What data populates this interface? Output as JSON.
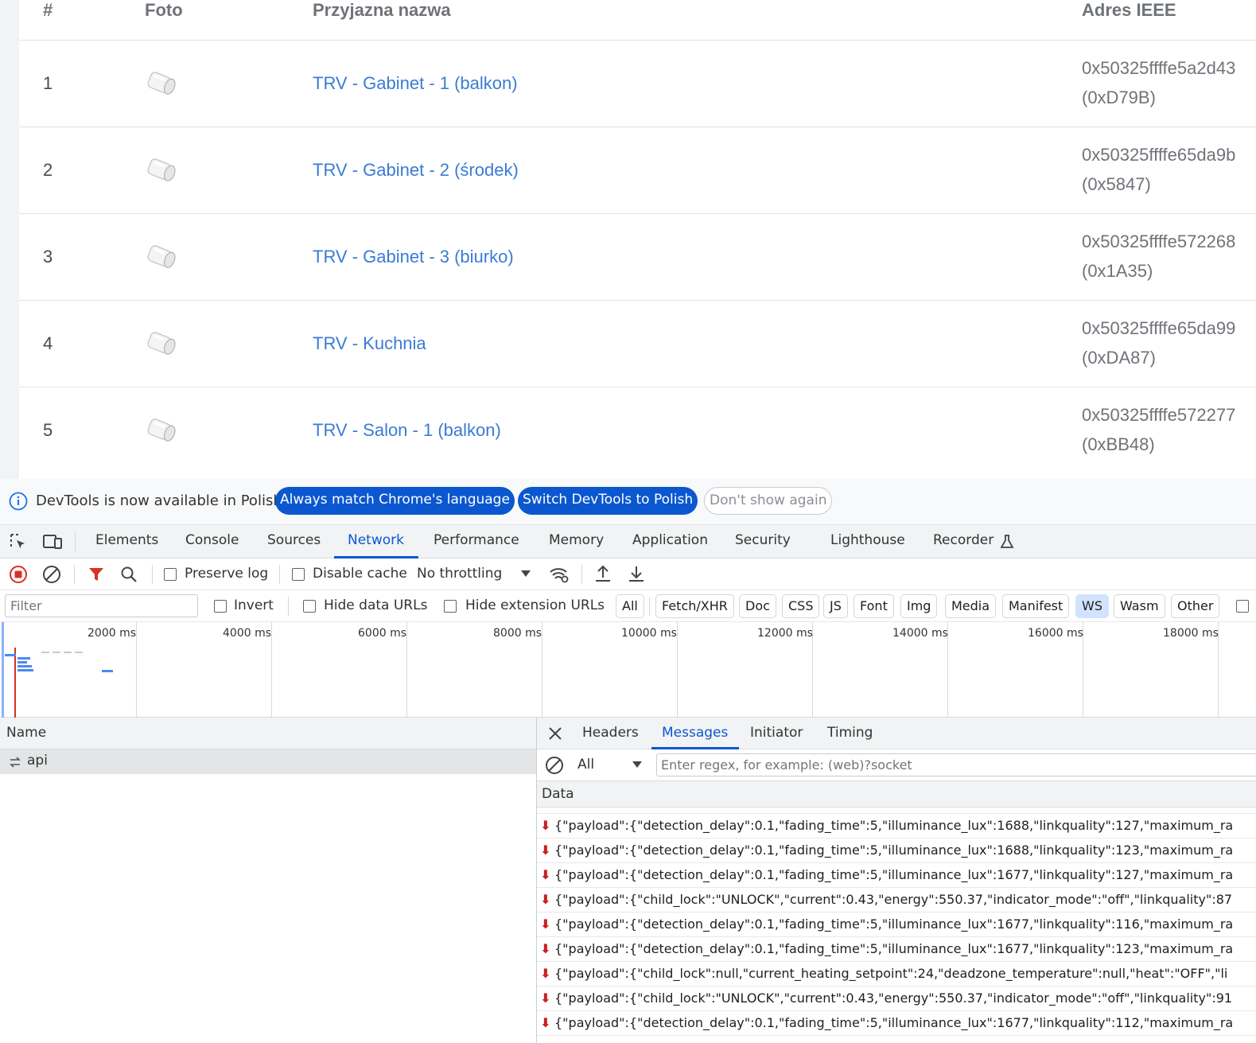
{
  "table": {
    "headers": {
      "num": "#",
      "photo": "Foto",
      "name": "Przyjazna nazwa",
      "ieee": "Adres IEEE"
    },
    "rows": [
      {
        "num": "1",
        "name": "TRV - Gabinet - 1 (balkon)",
        "ieee": "0x50325ffffe5a2d43",
        "nwk": "(0xD79B)"
      },
      {
        "num": "2",
        "name": "TRV - Gabinet - 2 (środek)",
        "ieee": "0x50325ffffe65da9b",
        "nwk": "(0x5847)"
      },
      {
        "num": "3",
        "name": "TRV - Gabinet - 3 (biurko)",
        "ieee": "0x50325ffffe572268",
        "nwk": "(0x1A35)"
      },
      {
        "num": "4",
        "name": "TRV - Kuchnia",
        "ieee": "0x50325ffffe65da99",
        "nwk": "(0xDA87)"
      },
      {
        "num": "5",
        "name": "TRV - Salon - 1 (balkon)",
        "ieee": "0x50325ffffe572277",
        "nwk": "(0xBB48)"
      }
    ]
  },
  "devtools": {
    "infobar": {
      "message": "DevTools is now available in Polish!",
      "match_button": "Always match Chrome's language",
      "switch_button": "Switch DevTools to Polish",
      "dismiss_button": "Don't show again"
    },
    "panels": [
      "Elements",
      "Console",
      "Sources",
      "Network",
      "Performance",
      "Memory",
      "Application",
      "Security",
      "Lighthouse",
      "Recorder"
    ],
    "active_panel": "Network",
    "toolbar": {
      "preserve_log": "Preserve log",
      "disable_cache": "Disable cache",
      "throttling": "No throttling"
    },
    "filter": {
      "placeholder": "Filter",
      "invert": "Invert",
      "hide_data_urls": "Hide data URLs",
      "hide_extension_urls": "Hide extension URLs",
      "types": [
        "All",
        "Fetch/XHR",
        "Doc",
        "CSS",
        "JS",
        "Font",
        "Img",
        "Media",
        "Manifest",
        "WS",
        "Wasm",
        "Other"
      ],
      "active_type": "WS"
    },
    "timeline_ticks": [
      "2000 ms",
      "4000 ms",
      "6000 ms",
      "8000 ms",
      "10000 ms",
      "12000 ms",
      "14000 ms",
      "16000 ms",
      "18000 ms"
    ],
    "requests": {
      "column_name": "Name",
      "items": [
        {
          "name": "api"
        }
      ]
    },
    "detail": {
      "tabs": [
        "Headers",
        "Messages",
        "Initiator",
        "Timing"
      ],
      "active_tab": "Messages",
      "message_filter": "All",
      "regex_placeholder": "Enter regex, for example: (web)?socket",
      "column_data": "Data",
      "messages": [
        "{\"payload\":{\"detection_delay\":0.1,\"fading_time\":5,\"illuminance_lux\":1688,\"linkquality\":127,\"maximum_ra",
        "{\"payload\":{\"detection_delay\":0.1,\"fading_time\":5,\"illuminance_lux\":1688,\"linkquality\":123,\"maximum_ra",
        "{\"payload\":{\"detection_delay\":0.1,\"fading_time\":5,\"illuminance_lux\":1677,\"linkquality\":127,\"maximum_ra",
        "{\"payload\":{\"child_lock\":\"UNLOCK\",\"current\":0.43,\"energy\":550.37,\"indicator_mode\":\"off\",\"linkquality\":87",
        "{\"payload\":{\"detection_delay\":0.1,\"fading_time\":5,\"illuminance_lux\":1677,\"linkquality\":116,\"maximum_ra",
        "{\"payload\":{\"detection_delay\":0.1,\"fading_time\":5,\"illuminance_lux\":1677,\"linkquality\":123,\"maximum_ra",
        "{\"payload\":{\"child_lock\":null,\"current_heating_setpoint\":24,\"deadzone_temperature\":null,\"heat\":\"OFF\",\"li",
        "{\"payload\":{\"child_lock\":\"UNLOCK\",\"current\":0.43,\"energy\":550.37,\"indicator_mode\":\"off\",\"linkquality\":91",
        "{\"payload\":{\"detection_delay\":0.1,\"fading_time\":5,\"illuminance_lux\":1677,\"linkquality\":112,\"maximum_ra"
      ]
    }
  }
}
